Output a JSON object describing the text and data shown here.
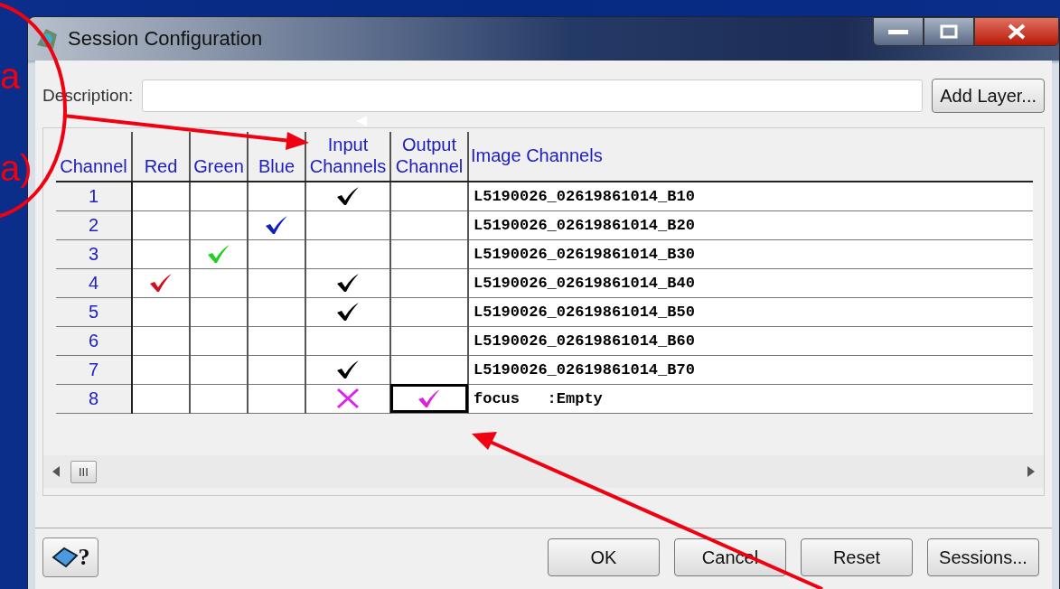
{
  "window": {
    "title": "Session Configuration"
  },
  "description": {
    "label": "Description:",
    "button": "Add Layer..."
  },
  "table": {
    "columns": [
      "Channel",
      "Red",
      "Green",
      "Blue",
      "Input Channels",
      "Output Channel",
      "Image Channels"
    ],
    "rows": [
      {
        "channel": "1",
        "red": false,
        "green": false,
        "blue": false,
        "input": true,
        "input_crossed": false,
        "output": false,
        "focused": false,
        "image": "L5190026_02619861014_B10"
      },
      {
        "channel": "2",
        "red": false,
        "green": false,
        "blue": true,
        "input": false,
        "input_crossed": false,
        "output": false,
        "focused": false,
        "image": "L5190026_02619861014_B20"
      },
      {
        "channel": "3",
        "red": false,
        "green": true,
        "blue": false,
        "input": false,
        "input_crossed": false,
        "output": false,
        "focused": false,
        "image": "L5190026_02619861014_B30"
      },
      {
        "channel": "4",
        "red": true,
        "green": false,
        "blue": false,
        "input": true,
        "input_crossed": false,
        "output": false,
        "focused": false,
        "image": "L5190026_02619861014_B40"
      },
      {
        "channel": "5",
        "red": false,
        "green": false,
        "blue": false,
        "input": true,
        "input_crossed": false,
        "output": false,
        "focused": false,
        "image": "L5190026_02619861014_B50"
      },
      {
        "channel": "6",
        "red": false,
        "green": false,
        "blue": false,
        "input": false,
        "input_crossed": false,
        "output": false,
        "focused": false,
        "image": "L5190026_02619861014_B60"
      },
      {
        "channel": "7",
        "red": false,
        "green": false,
        "blue": false,
        "input": true,
        "input_crossed": false,
        "output": false,
        "focused": false,
        "image": "L5190026_02619861014_B70"
      },
      {
        "channel": "8",
        "red": false,
        "green": false,
        "blue": false,
        "input": false,
        "input_crossed": true,
        "output": true,
        "focused": true,
        "image": "focus   :Empty"
      }
    ],
    "scrollbar_thumb": "III"
  },
  "help_button": "?",
  "buttons": [
    "OK",
    "Cancel",
    "Reset",
    "Sessions..."
  ],
  "annotations": [
    "a",
    "a)"
  ]
}
